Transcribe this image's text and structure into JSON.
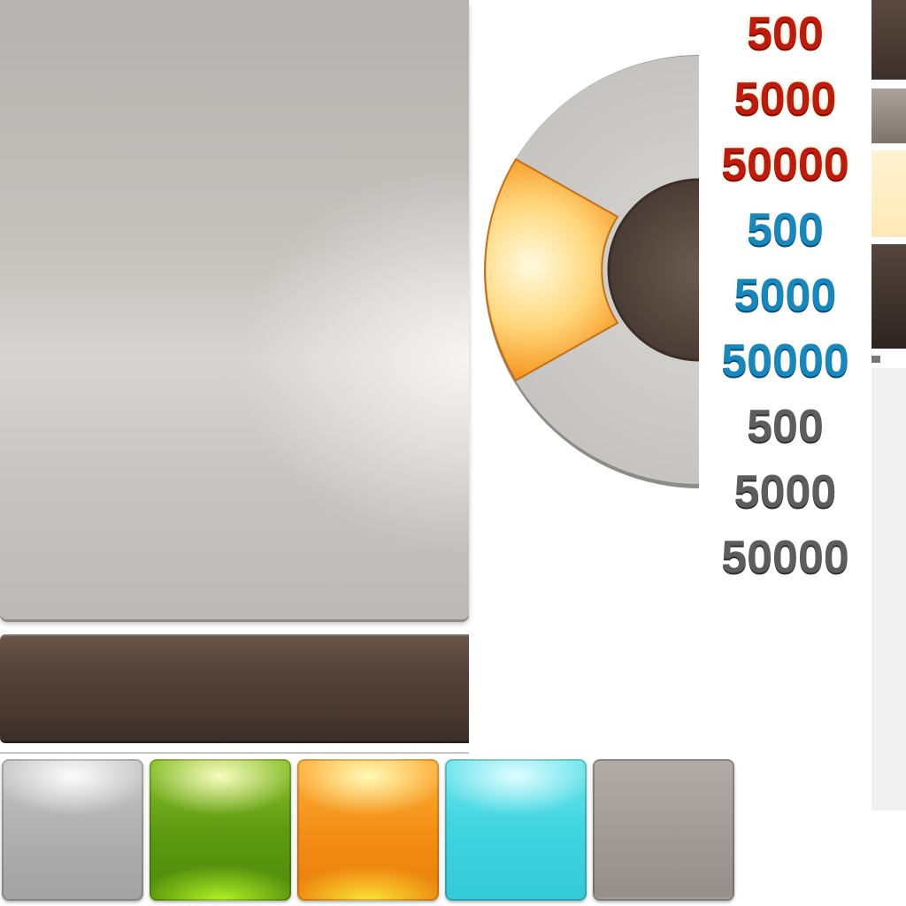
{
  "sprite": {
    "labels": {
      "red": [
        "500",
        "5000",
        "50000"
      ],
      "blue": [
        "500",
        "5000",
        "50000"
      ],
      "gray": [
        "500",
        "5000",
        "50000"
      ]
    },
    "colors": {
      "red": "#c01a0c",
      "blue": "#1688bd",
      "gray": "#5d5d5d",
      "wheel_highlight": "#ffb030",
      "leather": "#4a3a32"
    },
    "tiles": [
      "silver-tile",
      "green-tile",
      "orange-tile",
      "cyan-tile",
      "taupe-tile"
    ]
  }
}
